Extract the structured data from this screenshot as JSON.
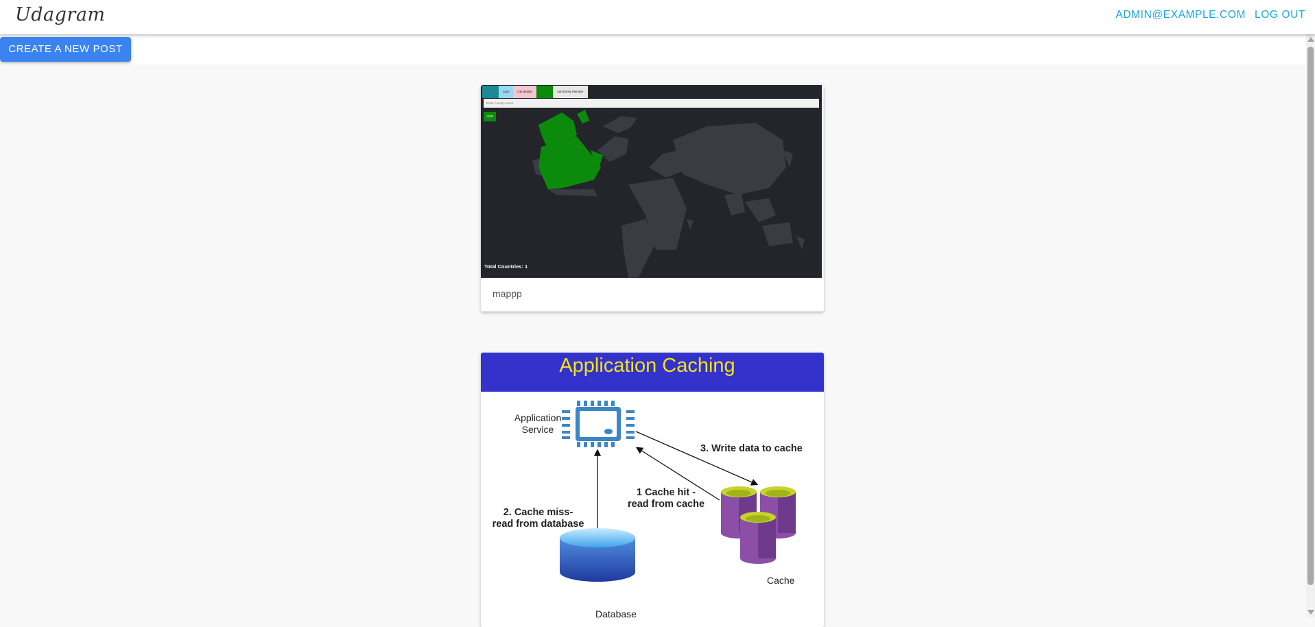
{
  "header": {
    "brand": "Udagram",
    "user_email": "ADMIN@EXAMPLE.COM",
    "logout_label": "LOG OUT"
  },
  "actions": {
    "create_post_label": "CREATE A NEW POST"
  },
  "feed": {
    "posts": [
      {
        "caption": "mappp",
        "image": {
          "tabs": [
            "",
            "Jack",
            "Get details",
            "",
            "Add family Member"
          ],
          "input_placeholder": "Enter country name",
          "add_label": "ADD",
          "total_countries": "Total Countries: 1"
        }
      },
      {
        "caption": "",
        "image": {
          "title": "Application Caching",
          "service_label": "Application Service",
          "step1": "1 Cache hit - read from cache",
          "step2": "2. Cache miss- read from database",
          "step3": "3. Write data to cache",
          "db_label": "Database",
          "cache_label": "Cache"
        }
      }
    ]
  },
  "colors": {
    "accent_blue": "#3b83f0",
    "nav_link": "#1aa6e0",
    "map_background": "#23252b",
    "map_land": "#3a3c44",
    "map_highlight": "#0b8a0b",
    "diagram_header": "#3333cc",
    "diagram_title": "#f4e21c",
    "cache_purple": "#8b4fa8",
    "db_blue": "#2a55b8"
  }
}
